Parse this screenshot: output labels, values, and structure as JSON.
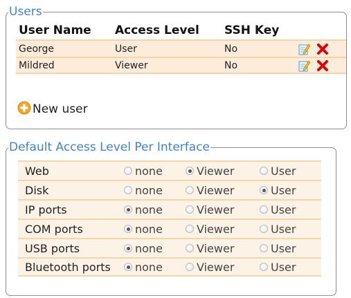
{
  "users": {
    "legend": "Users",
    "columns": [
      "User Name",
      "Access Level",
      "SSH Key"
    ],
    "rows": [
      {
        "name": "George",
        "level": "User",
        "ssh": "No"
      },
      {
        "name": "Mildred",
        "level": "Viewer",
        "ssh": "No"
      }
    ],
    "new_user_label": "New user"
  },
  "access": {
    "legend": "Default Access Level Per Interface",
    "options": [
      "none",
      "Viewer",
      "User"
    ],
    "rows": [
      {
        "interface": "Web",
        "selected": "Viewer"
      },
      {
        "interface": "Disk",
        "selected": "User"
      },
      {
        "interface": "IP ports",
        "selected": "none"
      },
      {
        "interface": "COM ports",
        "selected": "none"
      },
      {
        "interface": "USB ports",
        "selected": "none"
      },
      {
        "interface": "Bluetooth ports",
        "selected": "none"
      }
    ]
  },
  "colors": {
    "legend": "#3d85c6",
    "row_bg": "#fcecd9",
    "row_border": "#f6d3a8",
    "delete_icon": "#e00000",
    "add_icon": "#f5a623"
  },
  "icons": {
    "edit": "edit-icon",
    "delete": "delete-icon",
    "add": "add-icon"
  }
}
